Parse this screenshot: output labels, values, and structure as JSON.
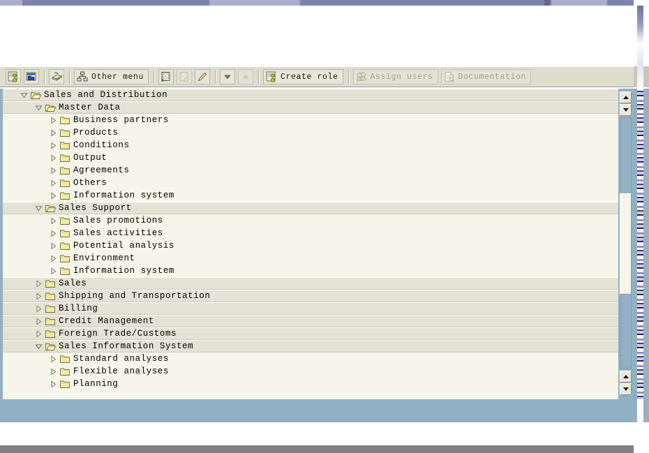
{
  "window": {
    "title_strip_color": "#7d84ab"
  },
  "toolbar": {
    "buttons": [
      {
        "id": "create-single-role",
        "name": "create-single-role-button",
        "icon": "person-page-icon",
        "label": "",
        "disabled": false
      },
      {
        "id": "create-composite-role",
        "name": "create-composite-role-button",
        "icon": "folder-window-icon",
        "label": "",
        "disabled": false
      },
      {
        "id": "transport",
        "name": "transport-button",
        "icon": "truck-icon",
        "label": "",
        "disabled": false
      },
      {
        "id": "other-menu",
        "name": "other-menu-button",
        "icon": "hierarchy-icon",
        "label": "Other menu",
        "disabled": false
      },
      {
        "id": "add-node",
        "name": "add-node-button",
        "icon": "add-node-icon",
        "label": "",
        "disabled": false
      },
      {
        "id": "remove-node",
        "name": "remove-node-button",
        "icon": "remove-node-icon",
        "label": "",
        "disabled": true
      },
      {
        "id": "edit-node",
        "name": "edit-node-button",
        "icon": "pencil-icon",
        "label": "",
        "disabled": false
      },
      {
        "id": "move-down",
        "name": "move-down-button",
        "icon": "triangle-down-icon",
        "label": "",
        "disabled": false
      },
      {
        "id": "move-up",
        "name": "move-up-button",
        "icon": "triangle-up-icon",
        "label": "",
        "disabled": true
      },
      {
        "id": "create-role",
        "name": "create-role-button",
        "icon": "person-page-icon",
        "label": "Create role",
        "disabled": false
      },
      {
        "id": "assign-users",
        "name": "assign-users-button",
        "icon": "users-icon",
        "label": "Assign users",
        "disabled": true
      },
      {
        "id": "documentation",
        "name": "documentation-button",
        "icon": "document-icon",
        "label": "Documentation",
        "disabled": true
      }
    ]
  },
  "tree": {
    "rows": [
      {
        "label": "Sales and Distribution",
        "indent": 1,
        "state": "expanded",
        "band": "lvl"
      },
      {
        "label": "Master Data",
        "indent": 2,
        "state": "expanded",
        "band": "lvl"
      },
      {
        "label": "Business partners",
        "indent": 3,
        "state": "collapsed",
        "band": "child"
      },
      {
        "label": "Products",
        "indent": 3,
        "state": "collapsed",
        "band": "child"
      },
      {
        "label": "Conditions",
        "indent": 3,
        "state": "collapsed",
        "band": "child"
      },
      {
        "label": "Output",
        "indent": 3,
        "state": "collapsed",
        "band": "child"
      },
      {
        "label": "Agreements",
        "indent": 3,
        "state": "collapsed",
        "band": "child"
      },
      {
        "label": "Others",
        "indent": 3,
        "state": "collapsed",
        "band": "child"
      },
      {
        "label": "Information system",
        "indent": 3,
        "state": "collapsed",
        "band": "child"
      },
      {
        "label": "Sales Support",
        "indent": 2,
        "state": "expanded",
        "band": "lvl"
      },
      {
        "label": "Sales promotions",
        "indent": 3,
        "state": "collapsed",
        "band": "child"
      },
      {
        "label": "Sales activities",
        "indent": 3,
        "state": "collapsed",
        "band": "child"
      },
      {
        "label": "Potential analysis",
        "indent": 3,
        "state": "collapsed",
        "band": "child"
      },
      {
        "label": "Environment",
        "indent": 3,
        "state": "collapsed",
        "band": "child"
      },
      {
        "label": "Information system",
        "indent": 3,
        "state": "collapsed",
        "band": "child"
      },
      {
        "label": "Sales",
        "indent": 2,
        "state": "collapsed",
        "band": "lvl"
      },
      {
        "label": "Shipping and Transportation",
        "indent": 2,
        "state": "collapsed",
        "band": "lvl"
      },
      {
        "label": "Billing",
        "indent": 2,
        "state": "collapsed",
        "band": "lvl"
      },
      {
        "label": "Credit Management",
        "indent": 2,
        "state": "collapsed",
        "band": "lvl"
      },
      {
        "label": "Foreign Trade/Customs",
        "indent": 2,
        "state": "collapsed",
        "band": "lvl"
      },
      {
        "label": "Sales Information System",
        "indent": 2,
        "state": "expanded",
        "band": "lvl"
      },
      {
        "label": "Standard analyses",
        "indent": 3,
        "state": "collapsed",
        "band": "child"
      },
      {
        "label": "Flexible analyses",
        "indent": 3,
        "state": "collapsed",
        "band": "child"
      },
      {
        "label": "Planning",
        "indent": 3,
        "state": "collapsed",
        "band": "child"
      }
    ]
  },
  "scrollbar": {
    "name": "tree-vertical-scrollbar",
    "top_up_icon": "triangle-up-icon",
    "top_down_icon": "triangle-down-icon",
    "bottom_up_icon": "triangle-up-icon",
    "bottom_down_icon": "triangle-down-icon"
  },
  "colors": {
    "toolbar_bg": "#ddddcf",
    "tree_bg": "#f6f5e9",
    "tree_band": "#e3e2d4",
    "panel_border": "#93afc4",
    "folder_open": "#e8e49a",
    "folder_closed": "#efeca6"
  }
}
